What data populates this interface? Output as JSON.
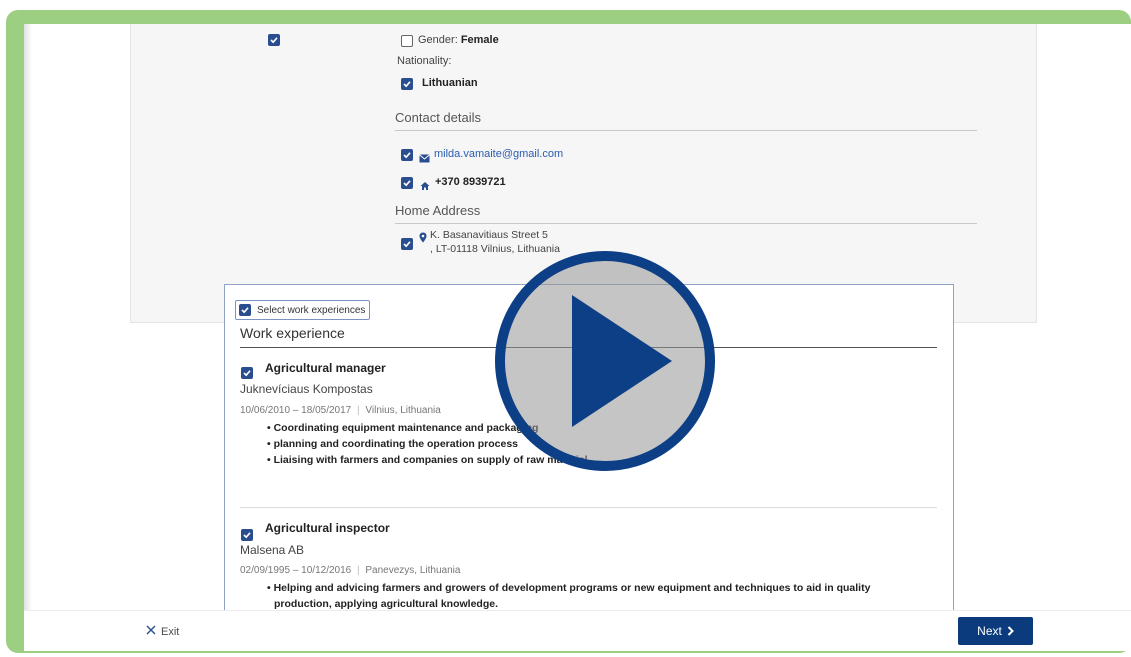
{
  "personal": {
    "gender_label": "Gender:",
    "gender_value": "Female",
    "nationality_label": "Nationality:",
    "nationality_value": "Lithuanian"
  },
  "contact": {
    "heading": "Contact details",
    "email": "milda.vamaite@gmail.com",
    "phone": "+370 8939721"
  },
  "address": {
    "heading": "Home Address",
    "line1": "K. Basanavitiaus Street 5",
    "line2": ", LT-01118  Vilnius, Lithuania"
  },
  "work": {
    "select_label": "Select work experiences",
    "heading": "Work experience",
    "items": [
      {
        "title": "Agricultural manager",
        "employer": "Juknevíciaus Kompostas",
        "dates": "10/06/2010 – 18/05/2017",
        "location": "Vilnius, Lithuania",
        "bullets": [
          "• Coordinating equipment maintenance and packaging",
          "• planning and coordinating the operation process",
          "• Liaising with farmers and companies on supply of raw material"
        ]
      },
      {
        "title": "Agricultural inspector",
        "employer": "Malsena AB",
        "dates": "02/09/1995 – 10/12/2016",
        "location": "Panevezys, Lithuania",
        "bullets": [
          "• Helping and advicing farmers and growers of development programs or new equipment and techniques to aid in quality",
          "production, applying agricultural knowledge."
        ]
      }
    ]
  },
  "footer": {
    "exit_label": "Exit",
    "next_label": "Next"
  },
  "colors": {
    "frame": "#9dcf82",
    "accent": "#2a4d8f",
    "next_button": "#0b3a7d",
    "play_ring": "#0d3f86"
  },
  "icons": [
    "checkbox-icon",
    "envelope-icon",
    "home-icon",
    "location-pin-icon",
    "close-icon",
    "chevron-right-icon",
    "play-icon"
  ]
}
